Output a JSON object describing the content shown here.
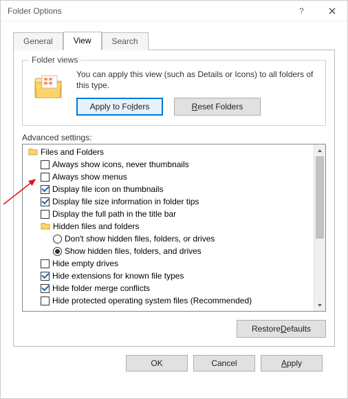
{
  "window": {
    "title": "Folder Options"
  },
  "tabs": {
    "general": "General",
    "view": "View",
    "search": "Search",
    "active": "view"
  },
  "folder_views": {
    "group_label": "Folder views",
    "desc": "You can apply this view (such as Details or Icons) to all folders of this type.",
    "apply_btn": {
      "pre": "Apply to Fo",
      "u": "l",
      "post": "ders"
    },
    "reset_btn": {
      "pre": "",
      "u": "R",
      "post": "eset Folders"
    }
  },
  "advanced": {
    "label": "Advanced settings:",
    "root_label": "Files and Folders",
    "hidden_group_label": "Hidden files and folders",
    "items": [
      {
        "kind": "check",
        "checked": false,
        "label": "Always show icons, never thumbnails"
      },
      {
        "kind": "check",
        "checked": false,
        "label": "Always show menus"
      },
      {
        "kind": "check",
        "checked": true,
        "label": "Display file icon on thumbnails"
      },
      {
        "kind": "check",
        "checked": true,
        "label": "Display file size information in folder tips"
      },
      {
        "kind": "check",
        "checked": false,
        "label": "Display the full path in the title bar"
      },
      {
        "kind": "radio",
        "checked": false,
        "label": "Don't show hidden files, folders, or drives"
      },
      {
        "kind": "radio",
        "checked": true,
        "label": "Show hidden files, folders, and drives"
      },
      {
        "kind": "check",
        "checked": false,
        "label": "Hide empty drives"
      },
      {
        "kind": "check",
        "checked": true,
        "label": "Hide extensions for known file types"
      },
      {
        "kind": "check",
        "checked": true,
        "label": "Hide folder merge conflicts"
      },
      {
        "kind": "check",
        "checked": false,
        "label": "Hide protected operating system files (Recommended)"
      }
    ],
    "restore_btn": {
      "pre": "Restore ",
      "u": "D",
      "post": "efaults"
    }
  },
  "dialog_buttons": {
    "ok": "OK",
    "cancel": "Cancel",
    "apply": {
      "pre": "",
      "u": "A",
      "post": "pply"
    }
  }
}
